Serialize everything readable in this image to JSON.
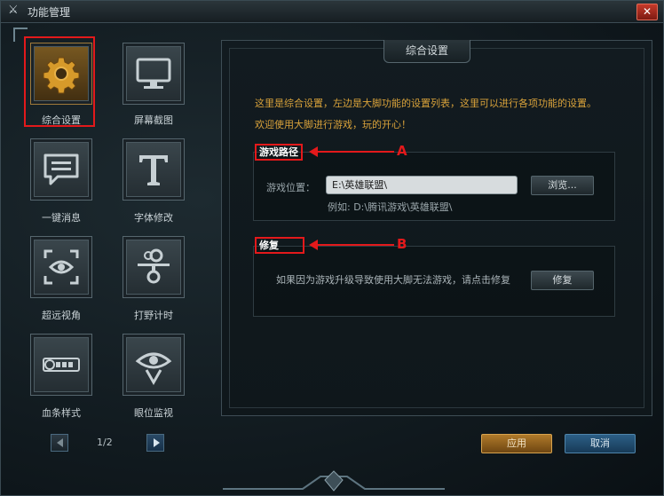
{
  "window": {
    "title": "功能管理",
    "close_symbol": "✕"
  },
  "sidebar": {
    "items": [
      {
        "label": "综合设置",
        "icon": "gear-icon",
        "active": true
      },
      {
        "label": "屏幕截图",
        "icon": "monitor-icon"
      },
      {
        "label": "一键消息",
        "icon": "chat-bubble-icon"
      },
      {
        "label": "字体修改",
        "icon": "font-t-icon"
      },
      {
        "label": "超远视角",
        "icon": "eye-frame-icon"
      },
      {
        "label": "打野计时",
        "icon": "stopwatch-icon"
      },
      {
        "label": "血条样式",
        "icon": "health-bar-icon"
      },
      {
        "label": "眼位监视",
        "icon": "ward-eye-icon"
      }
    ],
    "pager": {
      "current": "1/2"
    }
  },
  "panel": {
    "tab_title": "综合设置",
    "intro_line1": "这里是综合设置，左边是大脚功能的设置列表，这里可以进行各项功能的设置。",
    "intro_line2": "欢迎使用大脚进行游戏，玩的开心！",
    "game_path": {
      "title": "游戏路径",
      "marker": "A",
      "field_label": "游戏位置：",
      "value": "E:\\英雄联盟\\",
      "browse_label": "浏览...",
      "example": "例如: D:\\腾讯游戏\\英雄联盟\\"
    },
    "repair": {
      "title": "修复",
      "marker": "B",
      "desc": "如果因为游戏升级导致使用大脚无法游戏，请点击修复",
      "button_label": "修复"
    }
  },
  "footer": {
    "apply_label": "应用",
    "cancel_label": "取消"
  },
  "colors": {
    "accent_red": "#e3191b",
    "intro_text": "#d9a23a",
    "apply": "#b07a2a",
    "cancel": "#2c5f86"
  }
}
